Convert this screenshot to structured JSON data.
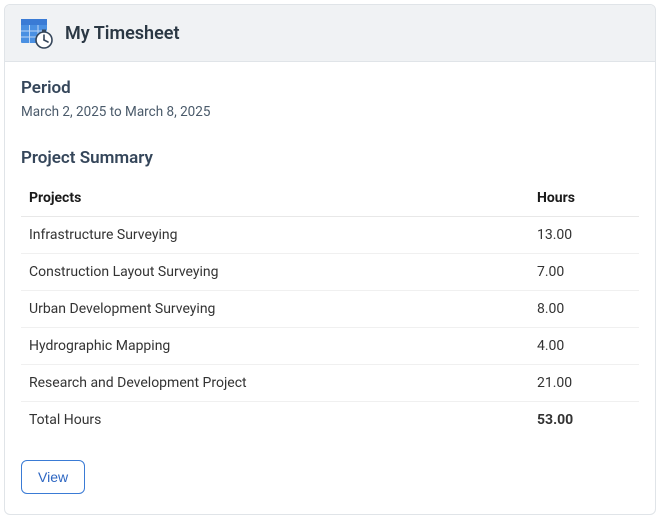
{
  "header": {
    "title": "My Timesheet"
  },
  "period": {
    "label": "Period",
    "value": "March 2, 2025 to March 8, 2025"
  },
  "summary": {
    "title": "Project Summary",
    "columns": {
      "projects": "Projects",
      "hours": "Hours"
    },
    "rows": [
      {
        "project": "Infrastructure Surveying",
        "hours": "13.00"
      },
      {
        "project": "Construction Layout Surveying",
        "hours": "7.00"
      },
      {
        "project": "Urban Development Surveying",
        "hours": "8.00"
      },
      {
        "project": "Hydrographic Mapping",
        "hours": "4.00"
      },
      {
        "project": "Research and Development Project",
        "hours": "21.00"
      }
    ],
    "total": {
      "label": "Total Hours",
      "hours": "53.00"
    }
  },
  "actions": {
    "view": "View"
  }
}
